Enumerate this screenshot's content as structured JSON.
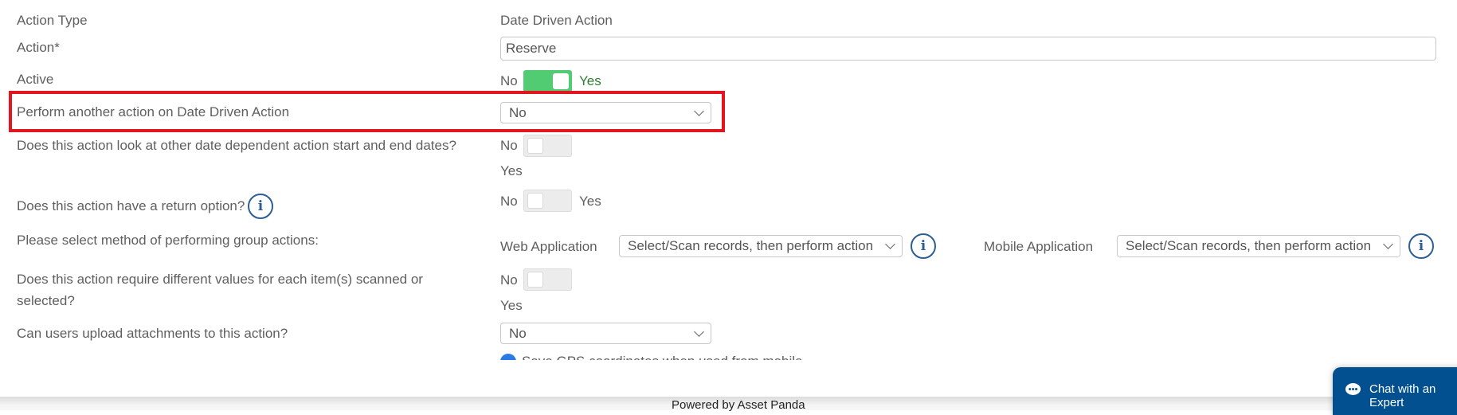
{
  "form": {
    "action_type": {
      "label": "Action Type",
      "value": "Date Driven Action"
    },
    "action": {
      "label": "Action*",
      "value": "Reserve"
    },
    "active": {
      "label": "Active",
      "off_label": "No",
      "on_label": "Yes",
      "state": true
    },
    "perform_another": {
      "label": "Perform another action on Date Driven Action",
      "selected": "No"
    },
    "look_other_dates": {
      "label": "Does this action look at other date dependent action start and end dates?",
      "off_label": "No",
      "on_label": "Yes",
      "state": false
    },
    "return_option": {
      "label": "Does this action have a return option?",
      "off_label": "No",
      "on_label": "Yes",
      "state": false,
      "info_icon": "info-icon"
    },
    "group_method": {
      "label": "Please select method of performing group actions:",
      "web": {
        "label": "Web Application",
        "selected": "Select/Scan records, then perform action"
      },
      "mobile": {
        "label": "Mobile Application",
        "selected": "Select/Scan records, then perform action"
      }
    },
    "different_values": {
      "label_line1": "Does this action require different values for each item(s) scanned or",
      "label_line2": "selected?",
      "off_label": "No",
      "on_label": "Yes",
      "state": false
    },
    "attachments": {
      "label": "Can users upload attachments to this action?",
      "selected": "No"
    },
    "gps": {
      "label": "Save GPS coordinates when used from mobile",
      "checked": true
    }
  },
  "highlight": {
    "color": "#e3161f"
  },
  "footer": {
    "text": "Powered by Asset Panda"
  },
  "chat": {
    "label": "Chat with an Expert"
  },
  "colors": {
    "toggle_on": "#52cc73",
    "info": "#2c5e94",
    "chat_bg": "#02508f"
  }
}
